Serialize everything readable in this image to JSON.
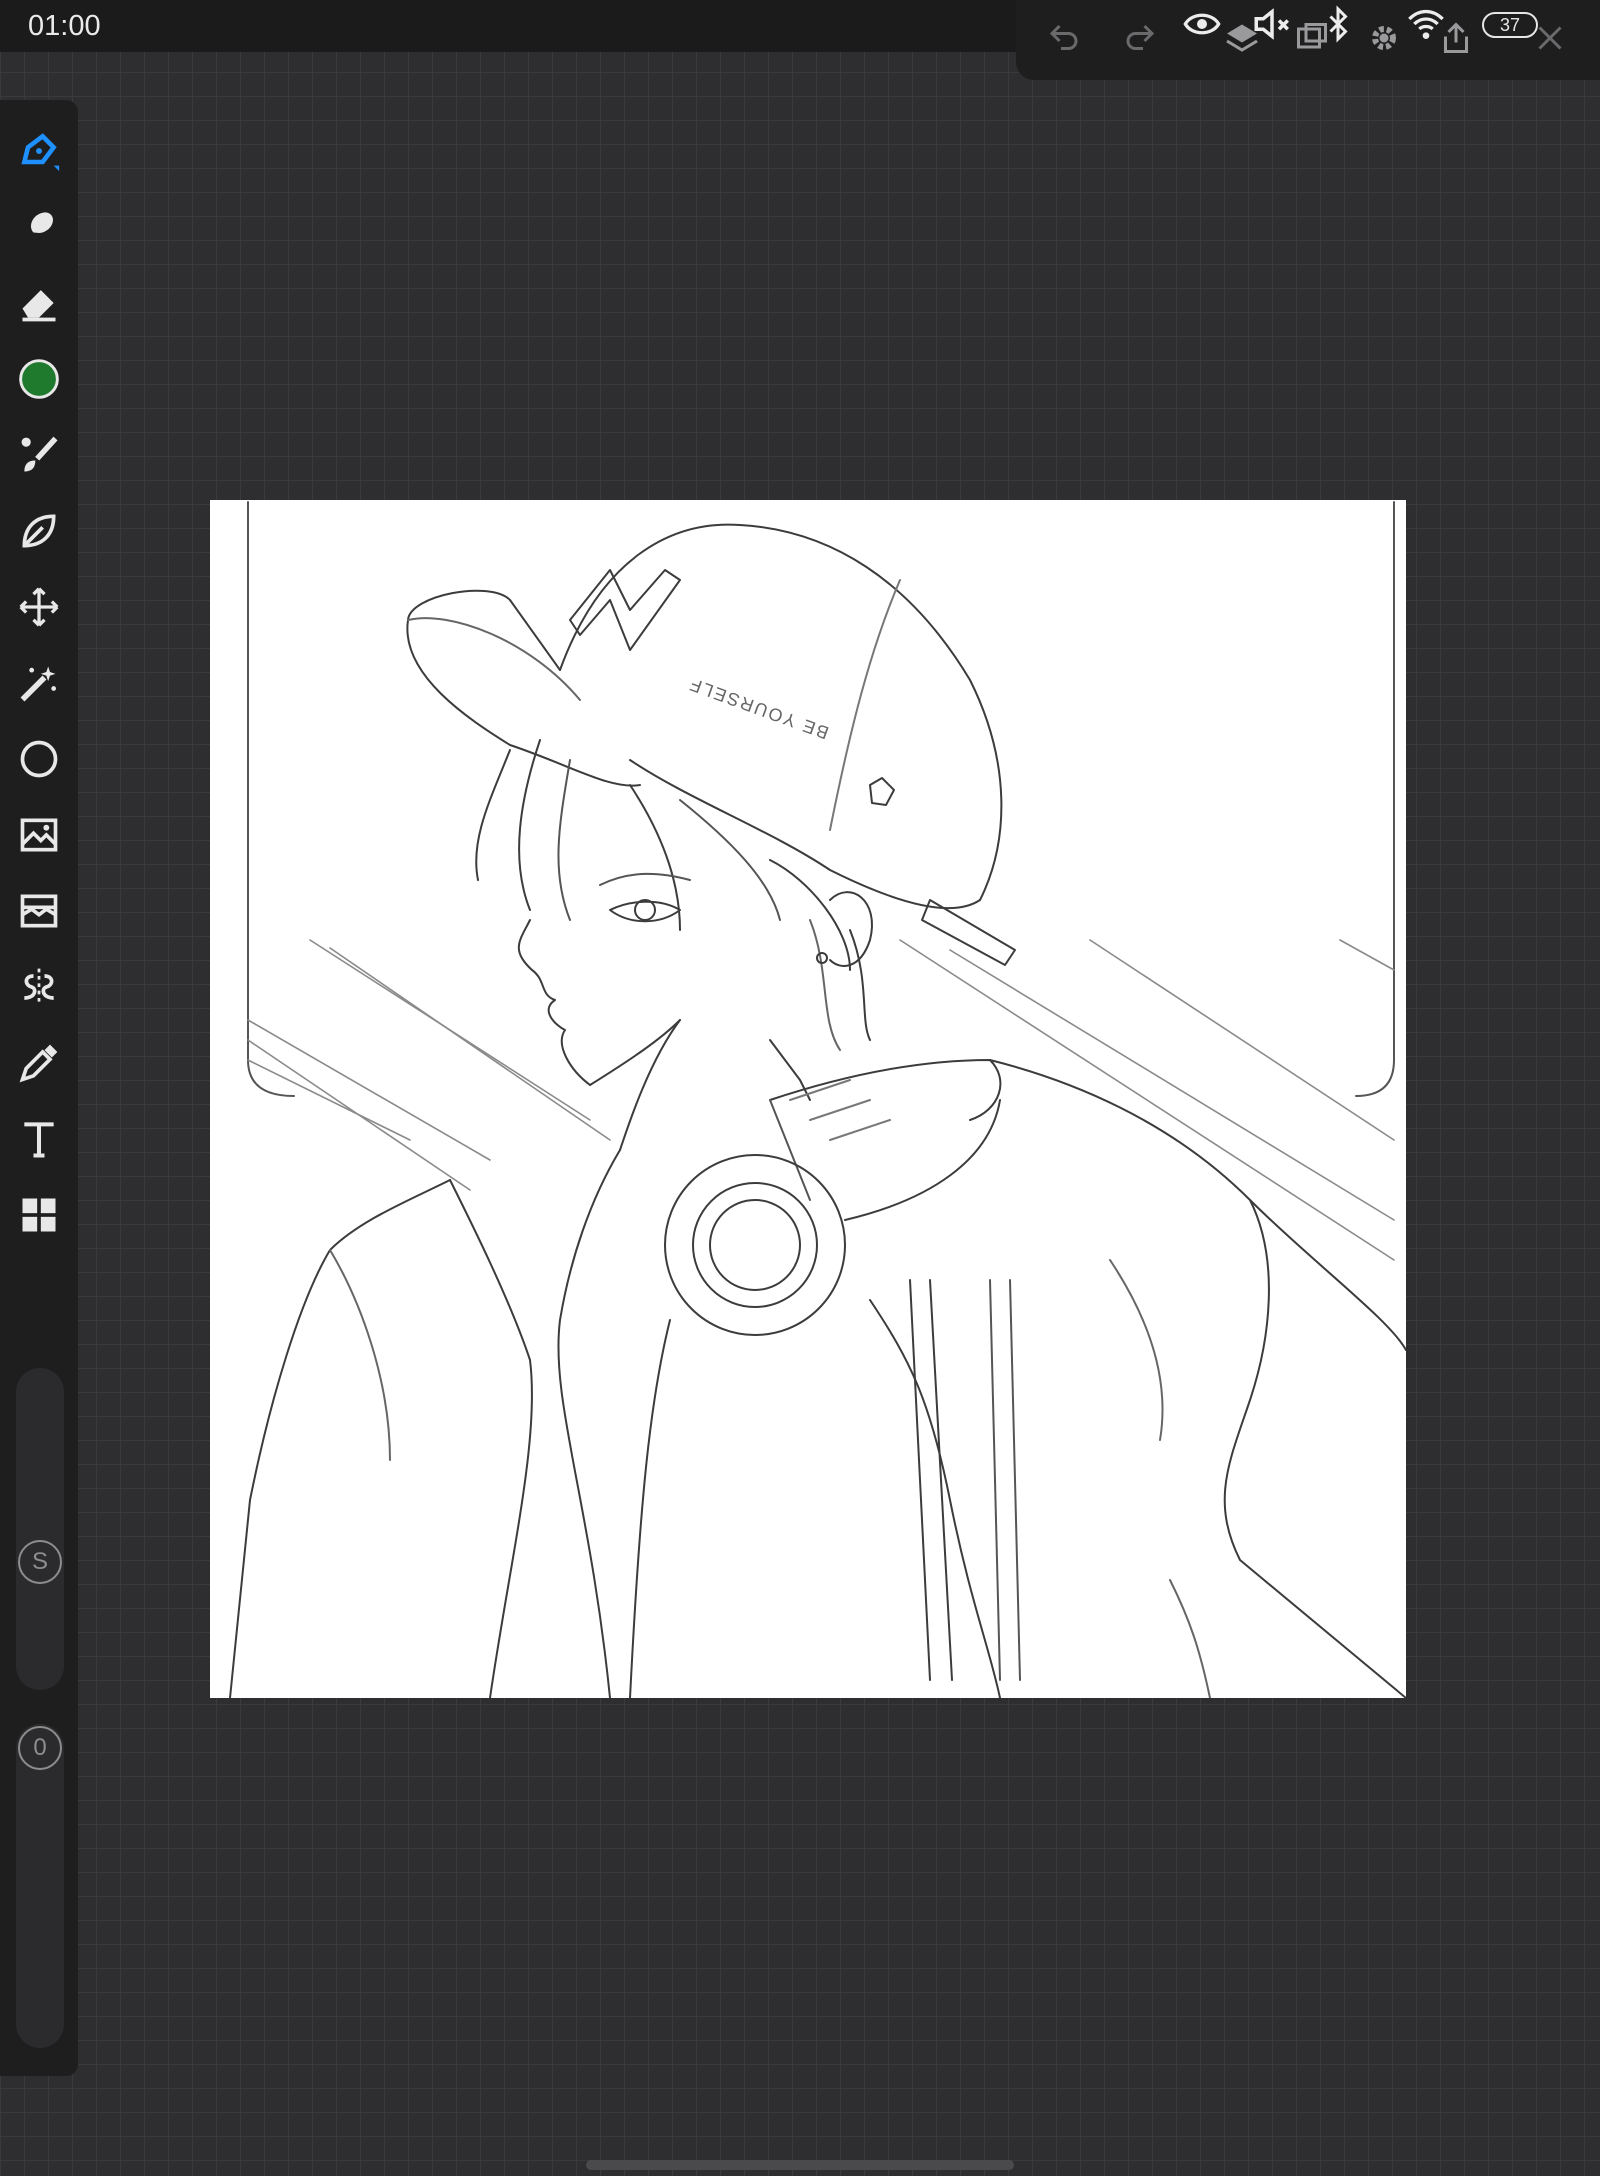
{
  "status_bar": {
    "time": "01:00",
    "battery_level": "37"
  },
  "canvas": {
    "cap_text": "BE YOURSELF"
  },
  "sliders": {
    "size_label": "S",
    "opacity_label": "0"
  },
  "colors": {
    "current_color": "#1f7a2e",
    "active_tool": "#1e90ff",
    "icon": "#e8e8e8"
  }
}
